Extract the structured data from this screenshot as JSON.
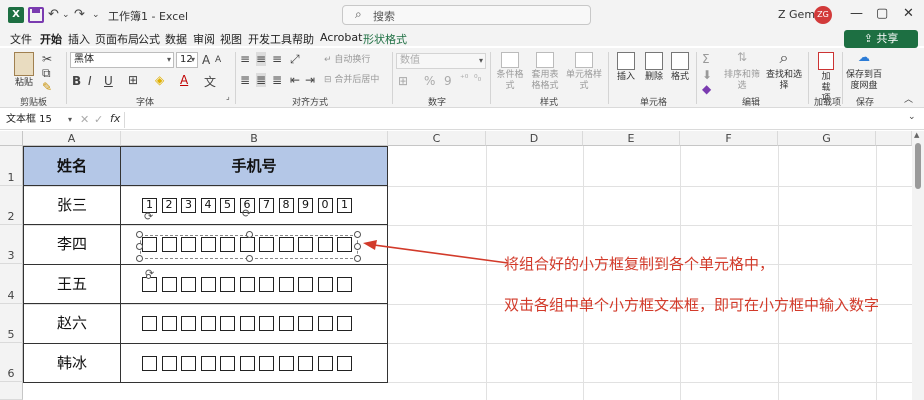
{
  "titlebar": {
    "title": "工作簿1 - Excel",
    "search_placeholder": "搜索",
    "user_name": "Z Gemini",
    "user_initials": "ZG",
    "qa_undo": "↶",
    "qa_redo": "↷",
    "qa_more": "⌄",
    "min": "—",
    "max": "▢",
    "close": "✕"
  },
  "tabs": [
    "文件",
    "开始",
    "插入",
    "页面布局",
    "公式",
    "数据",
    "审阅",
    "视图",
    "开发工具",
    "帮助",
    "Acrobat",
    "形状格式"
  ],
  "active_tab": "开始",
  "share_label": "共享",
  "ribbon": {
    "clipboard": {
      "paste": "粘贴",
      "label": "剪贴板"
    },
    "font": {
      "name": "黑体",
      "size": "12",
      "bold": "B",
      "italic": "I",
      "underline": "U",
      "grow": "A",
      "shrink": "A",
      "color_a": "A",
      "wen": "文",
      "label": "字体"
    },
    "align": {
      "wrap": "自动换行",
      "merge": "合并后居中",
      "label": "对齐方式"
    },
    "number": {
      "format": "数值",
      "pct": "%",
      "comma": "9",
      "label": "数字"
    },
    "styles": {
      "cond": "条件格式",
      "table": "套用表格格式",
      "cell": "单元格样式",
      "label": "样式"
    },
    "cells": {
      "insert": "插入",
      "delete": "删除",
      "format": "格式",
      "label": "单元格"
    },
    "editing": {
      "sort": "排序和筛选",
      "find": "查找和选择",
      "label": "编辑"
    },
    "addins": {
      "btn": "加载项",
      "label": "加载项"
    },
    "baidu": {
      "btn": "保存到百度网盘",
      "label": "保存"
    }
  },
  "formula_bar": {
    "name_box": "文本框 15",
    "fx": "fx",
    "cancel": "✕",
    "enter": "✓"
  },
  "columns": [
    "A",
    "B",
    "C",
    "D",
    "E",
    "F",
    "G"
  ],
  "rows": [
    "1",
    "2",
    "3",
    "4",
    "5",
    "6"
  ],
  "table": {
    "header": {
      "name": "姓名",
      "phone": "手机号"
    },
    "names": [
      "张三",
      "李四",
      "王五",
      "赵六",
      "韩冰"
    ],
    "digits": [
      "1",
      "2",
      "3",
      "4",
      "5",
      "6",
      "7",
      "8",
      "9",
      "0",
      "1"
    ]
  },
  "annotations": [
    "将组合好的小方框复制到各个单元格中，",
    "双击各组中单个小方框文本框，即可在小方框中输入数字"
  ],
  "colors": {
    "accent": "#1d6f42",
    "header_fill": "#b4c7e7",
    "note": "#d23a2a"
  }
}
